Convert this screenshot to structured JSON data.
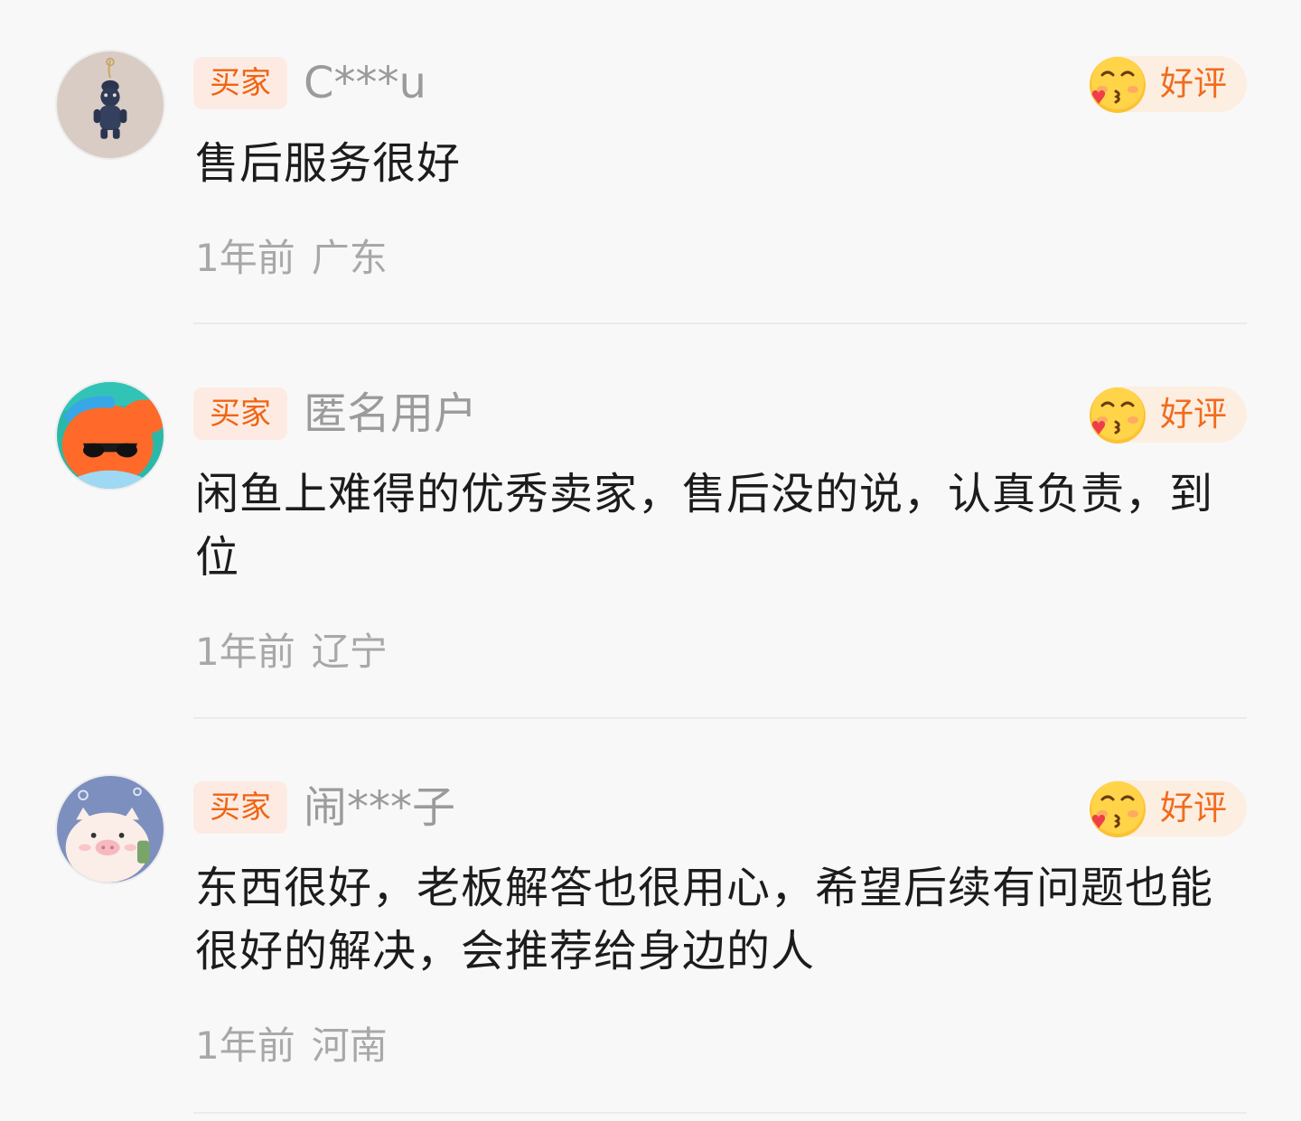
{
  "reviews": [
    {
      "role": "买家",
      "username": "C***u",
      "rating": "好评",
      "comment": "售后服务很好",
      "time": "1年前",
      "location": "广东",
      "avatar": "bear-keychain-avatar"
    },
    {
      "role": "买家",
      "username": "匿名用户",
      "rating": "好评",
      "comment": "闲鱼上难得的优秀卖家，售后没的说，认真负责，到位",
      "time": "1年前",
      "location": "辽宁",
      "avatar": "fish-sunglasses-avatar"
    },
    {
      "role": "买家",
      "username": "闹***子",
      "rating": "好评",
      "comment": "东西很好，老板解答也很用心，希望后续有问题也能很好的解决，会推荐给身边的人",
      "time": "1年前",
      "location": "河南",
      "avatar": "pig-avatar"
    }
  ],
  "colors": {
    "background": "#f8f8f8",
    "badge_bg": "#fdebe3",
    "badge_text": "#f06412",
    "rating_bg": "#fdeee2",
    "rating_text": "#f06c1e",
    "username": "#9b9b9b",
    "comment": "#1c1c1c",
    "meta": "#a8a8a8"
  }
}
